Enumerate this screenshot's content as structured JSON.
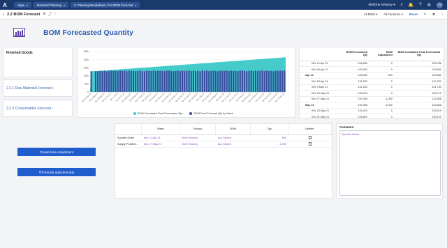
{
  "topbar": {
    "logo": "A",
    "crumbs": [
      "Apps",
      "Demand Planning",
      "2. Planning Breakdown / 2.2 BOM Forecast"
    ],
    "account": "MeltOne Advisory",
    "avatar": "CM"
  },
  "subbar": {
    "title": "2.2 BOM Forecast",
    "filter_bom": "All BOM",
    "filter_factories": "All Factories",
    "reset": "Reset"
  },
  "page_title": "BOM Forecasted Quantity",
  "left_cards": {
    "finished_goods": "Finished Goods",
    "raw_materials": "2.2.1 Raw Materials Forecast",
    "consumables": "2.2.2 Consumables Forecast"
  },
  "chart_data": {
    "type": "bar",
    "ylim": [
      0,
      250
    ],
    "yticks": [
      "0",
      "50k",
      "100k",
      "150k",
      "200k",
      "250k"
    ],
    "x_labels": [
      "Wc 12 Apr 21",
      "Wc 19 Apr 21",
      "Wc 26 Apr 21",
      "Wc 3 May 21",
      "Wc 10 May 21",
      "Wc 17 May 21",
      "Wc 24 May 21",
      "Wc 31 May 21",
      "Wc 7 Jun 21",
      "Wc 14 Jun 21",
      "Wc 21 Jun 21",
      "Wc 28 Jun 21",
      "Wc 5 Jul 21",
      "Wc 12 Jul 21",
      "Wc 19 Jul 21",
      "Wc 26 Jul 21",
      "Wc 2 Aug 21",
      "Wc 9 Aug 21",
      "Wc 16 Aug 21",
      "Wc 23 Aug 21",
      "Wc 30 Aug 21",
      "Wc 6 Sep 21",
      "Wc 13 Sep 21",
      "Wc 20 Sep 21",
      "Wc 27 Sep 21",
      "Wc 4 Oct 21",
      "Wc 11 Oct 21",
      "Wc 18 Oct 21",
      "Wc 25 Oct 21",
      "Wc 1 Nov 21",
      "Wc 8 Nov 21",
      "Wc 15 Nov 21",
      "Wc 22 Nov 21",
      "Wc 29 Nov 21",
      "Wc 6 Dec 21",
      "Wc 13 Dec 21",
      "Wc 20 Dec 21",
      "Wc 27 Dec 21",
      "Wc 3 Jan 22",
      "Wc 10 Jan 22",
      "Wc 17 Jan 22",
      "Wc 24 Jan 22",
      "Wc 31 Jan 22",
      "Wc 7 Feb 22",
      "Wc 14 Feb 22",
      "Wc 21 Feb 22",
      "Wc 28 Feb 22",
      "Wc 7 Mar 22",
      "Wc 14 Mar 22",
      "Wc 21 Mar 22",
      "Wc 28 Mar 22",
      "Wc 4 Apr 22",
      "Wc 11 Apr 22",
      "Wc 18 Apr 22",
      "Wc 25 Apr 22",
      "Wc 2 May 22",
      "Wc 9 May 22",
      "Wc 16 May 22",
      "Wc 23 May 22",
      "Wc 30 May 22",
      "Wc 6 Jun 22",
      "Wc 13 Jun 22",
      "Wc 20 Jun 22",
      "Wc 27 Jun 22",
      "Wc 4 Jul 22",
      "Wc 11 Jul 22",
      "Wc 18 Jul 22",
      "Wc 25 Jul 22",
      "Wc 1 Aug 22",
      "Wc 8 Aug 22",
      "Wc 15 Aug 22",
      "Wc 22 Aug 22",
      "Wc 29 Aug 22",
      "Wc 5 Sep 22",
      "Wc 12 Sep 22",
      "Wc 19 Sep 22",
      "Wc 26 Sep 22",
      "Wc 3 Oct 22",
      "Wc 10 Oct 22",
      "Wc 17 Oct 22",
      "Wc 24 Oct 22",
      "Wc 31 Oct 22",
      "Wc 7 Nov 22",
      "Wc 14 Nov 22",
      "Wc 21 Nov 22",
      "Wc 28 Nov 22",
      "Wc 5 Dec 22",
      "Wc 12 Dec 22"
    ],
    "x_label_step": 3,
    "series": [
      {
        "name": "BOM Cumulated Final Forecasted Qty",
        "type": "area",
        "color": "#3cc8c8",
        "values": [
          128,
          129,
          129,
          130,
          131,
          132,
          133,
          133,
          135,
          136,
          137,
          138,
          139,
          140,
          141,
          142,
          143,
          144,
          145,
          146,
          147,
          148,
          149,
          150,
          151,
          152,
          153,
          154,
          155,
          156,
          157,
          158,
          159,
          160,
          161,
          162,
          163,
          164,
          165,
          166,
          167,
          168,
          169,
          170,
          171,
          172,
          173,
          174,
          175,
          176,
          177,
          178,
          179,
          180,
          181,
          182,
          183,
          184,
          185,
          186,
          187,
          188,
          189,
          190,
          191,
          192,
          193,
          194,
          195,
          196,
          197,
          198,
          199,
          200,
          201,
          202,
          203,
          204,
          205,
          206,
          207,
          208,
          209,
          210,
          211,
          212,
          213,
          214
        ]
      },
      {
        "name": "BOM Final Forecast Qty by Week",
        "type": "bar",
        "color": "#3b4a9e",
        "values": [
          128,
          1,
          128,
          129,
          131,
          128,
          132,
          128,
          130,
          133,
          131,
          132,
          129,
          133,
          131,
          132,
          128,
          133,
          130,
          132,
          129,
          131,
          133,
          130,
          128,
          132,
          131,
          130,
          133,
          129,
          132,
          131,
          130,
          129,
          133,
          132,
          131,
          128,
          130,
          133,
          129,
          132,
          130,
          131,
          133,
          129,
          132,
          130,
          131,
          128,
          133,
          130,
          132,
          129,
          131,
          133,
          130,
          128,
          132,
          131,
          130,
          133,
          129,
          132,
          131,
          130,
          129,
          133,
          132,
          131,
          128,
          130,
          133,
          129,
          132,
          130,
          131,
          133,
          129,
          132,
          130,
          131,
          128,
          133,
          130,
          132,
          131,
          133
        ]
      }
    ]
  },
  "forecast_table": {
    "headers": [
      "",
      "BOM Forecasted Qty",
      "BOM Adjustment",
      "BOM Cumulated Final Forecasted Qty"
    ],
    "rows": [
      {
        "type": "week",
        "cells": [
          "W/c 12 Apr 21",
          "128,286",
          "0",
          "128,786"
        ]
      },
      {
        "type": "week",
        "cells": [
          "W/c 19 Apr 21",
          "129,332",
          "0",
          "129,832"
        ]
      },
      {
        "type": "month",
        "cells": [
          "Apr 21",
          "128,332",
          "500",
          "129,832"
        ]
      },
      {
        "type": "week",
        "cells": [
          "W/c 26 Apr 21",
          "130,252",
          "0",
          "130,752"
        ]
      },
      {
        "type": "week",
        "cells": [
          "W/c 3 May 21",
          "131,253",
          "0",
          "131,753"
        ]
      },
      {
        "type": "week",
        "cells": [
          "W/c 10 May 21",
          "132,213",
          "0",
          "132,713"
        ]
      },
      {
        "type": "week",
        "cells": [
          "W/c 17 May 21",
          "133,308",
          "-1,000",
          "132,808"
        ]
      },
      {
        "type": "month",
        "cells": [
          "May 21",
          "133,308",
          "-1,000",
          "132,808"
        ]
      },
      {
        "type": "week",
        "cells": [
          "W/c 24 May 21",
          "134,415",
          "0",
          "133,915"
        ]
      },
      {
        "type": "week",
        "cells": [
          "W/c 31 May 21",
          "135,620",
          "0",
          "135,120"
        ]
      },
      {
        "type": "week",
        "cells": [
          "W/c 7 Jun 21",
          "136,524",
          "0",
          "136,024"
        ]
      }
    ]
  },
  "buttons": {
    "create": "Create New Adjustment",
    "forecast": "Forecast adjustment(s)"
  },
  "adjustments": {
    "headers": [
      "",
      "Week",
      "Factory",
      "BOM",
      "Qty",
      "Delete?"
    ],
    "rows": [
      {
        "label": "Specific Order",
        "week": "W/c 12 Apr 21",
        "factory": "North Factory",
        "bom": "Acc Sleeve",
        "qty": "500"
      },
      {
        "label": "Supply Problem...",
        "week": "W/c 17 May 21",
        "factory": "North Factory",
        "bom": "Acc Sleeve",
        "qty": "-1,000"
      }
    ]
  },
  "comment": {
    "label": "Comment",
    "text": "Specific Order"
  }
}
